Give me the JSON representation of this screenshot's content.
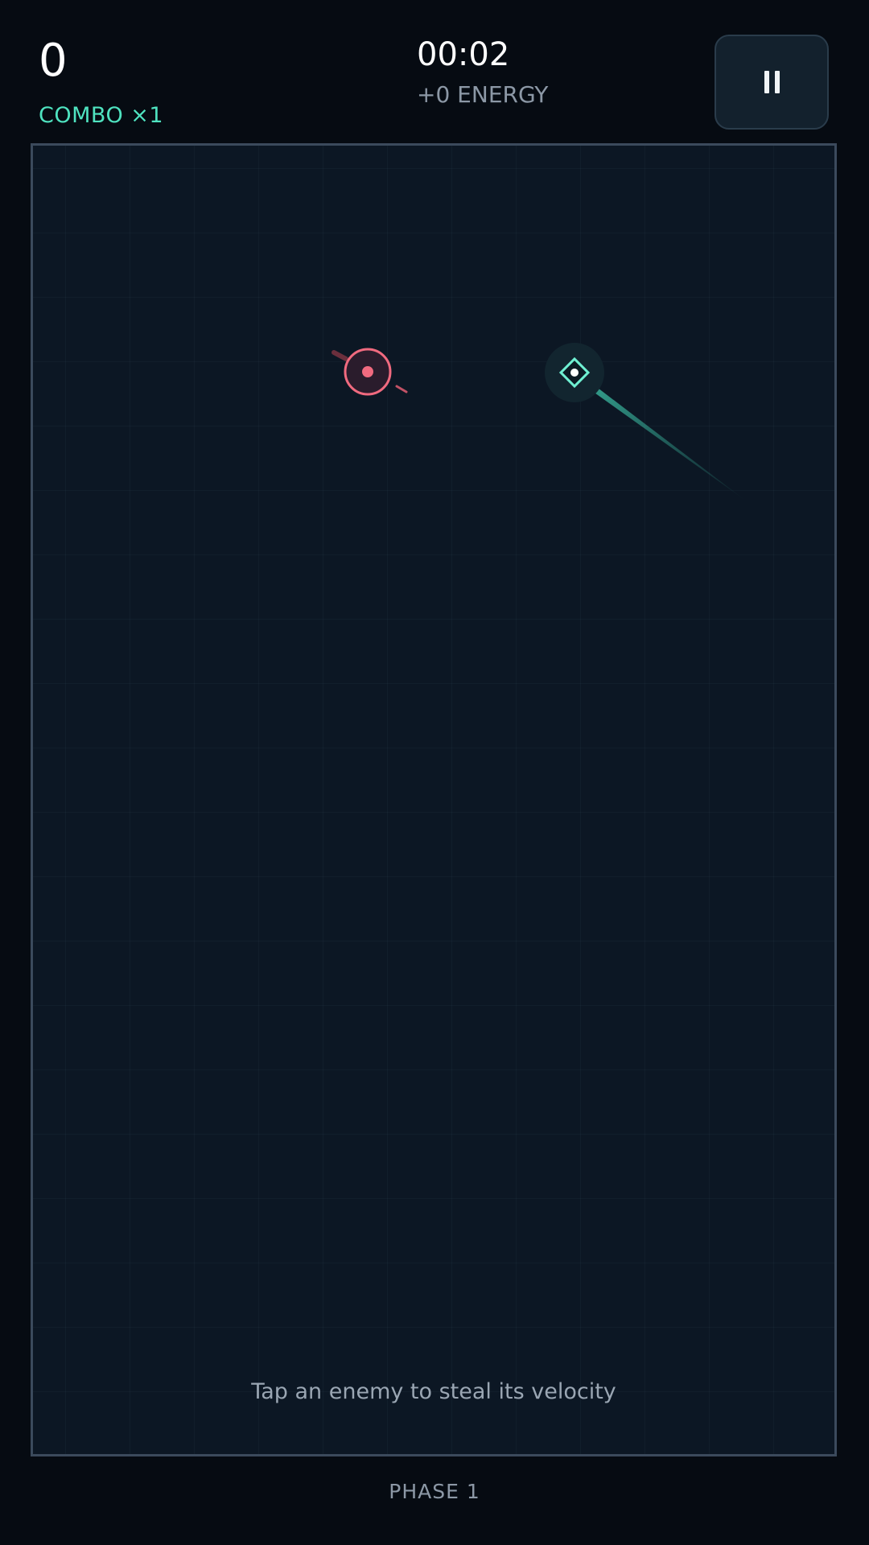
{
  "hud": {
    "score": "0",
    "combo": "COMBO ×1",
    "timer": "00:02",
    "energy": "+0 ENERGY"
  },
  "pause_button": {
    "icon": "pause-icon"
  },
  "arena": {
    "hint": "Tap an enemy to steal its velocity",
    "enemy": {
      "icon": "enemy-target-icon",
      "color": "#f06a7f"
    },
    "player": {
      "icon": "player-diamond-icon",
      "color": "#4fe3c0"
    }
  },
  "footer": {
    "phase": "PHASE 1"
  },
  "colors": {
    "background": "#060b12",
    "arena": "#0c1724",
    "accent": "#4fe3c0",
    "enemy": "#f06a7f"
  }
}
